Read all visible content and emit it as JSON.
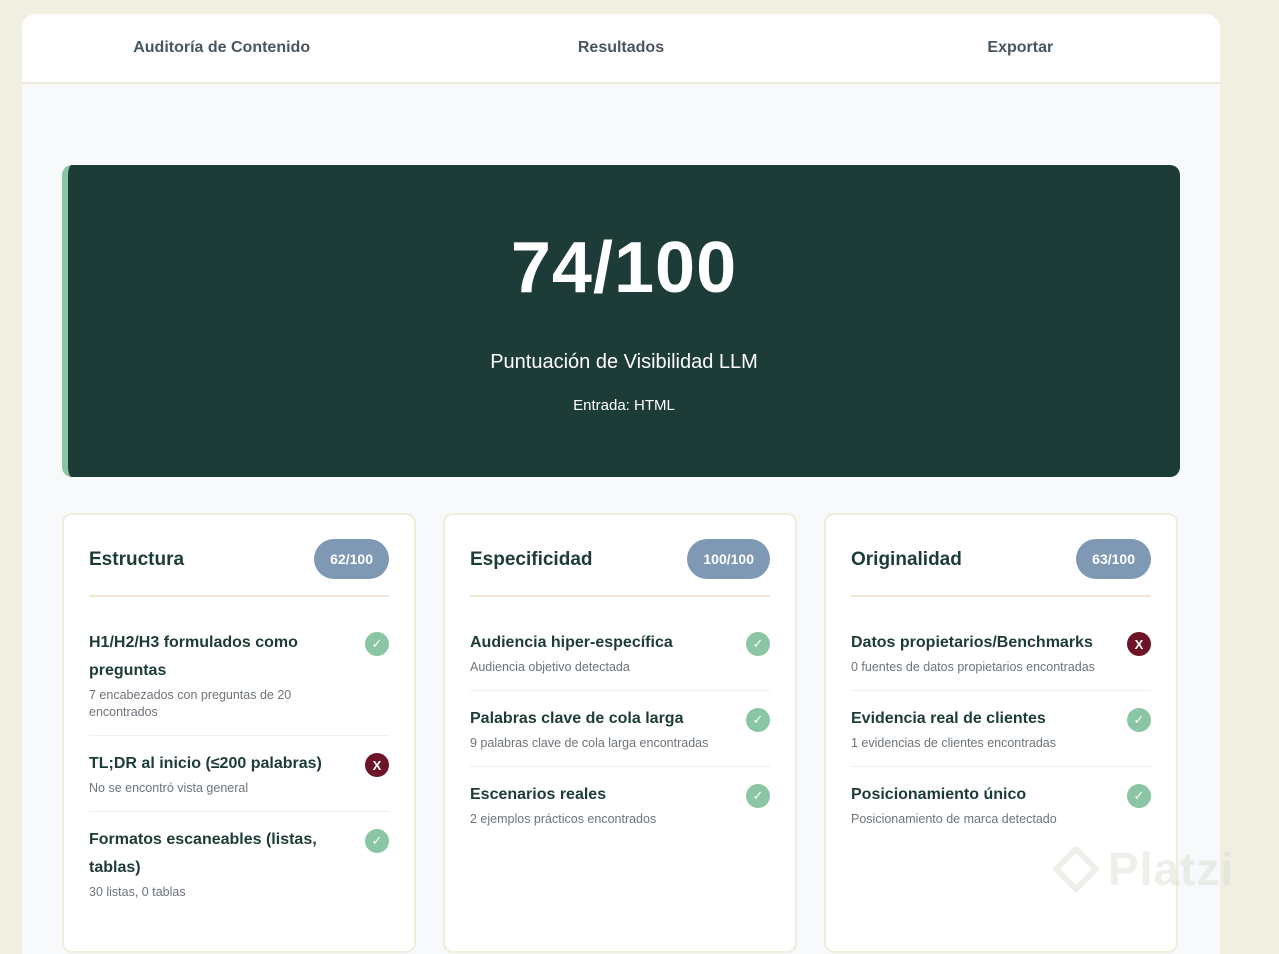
{
  "tabs": [
    {
      "label": "Auditoría de Contenido"
    },
    {
      "label": "Resultados"
    },
    {
      "label": "Exportar"
    }
  ],
  "hero": {
    "score": "74/100",
    "label": "Puntuación de Visibilidad LLM",
    "input": "Entrada: HTML"
  },
  "cards": [
    {
      "title": "Estructura",
      "badge": "62/100",
      "items": [
        {
          "title": "H1/H2/H3 formulados como preguntas",
          "desc": "7 encabezados con preguntas de 20 encontrados",
          "status": "ok"
        },
        {
          "title": "TL;DR al inicio (≤200 palabras)",
          "desc": "No se encontró vista general",
          "status": "fail"
        },
        {
          "title": "Formatos escaneables (listas, tablas)",
          "desc": "30 listas, 0 tablas",
          "status": "ok"
        }
      ]
    },
    {
      "title": "Especificidad",
      "badge": "100/100",
      "items": [
        {
          "title": "Audiencia hiper-específica",
          "desc": "Audiencia objetivo detectada",
          "status": "ok"
        },
        {
          "title": "Palabras clave de cola larga",
          "desc": "9 palabras clave de cola larga encontradas",
          "status": "ok"
        },
        {
          "title": "Escenarios reales",
          "desc": "2 ejemplos prácticos encontrados",
          "status": "ok"
        }
      ]
    },
    {
      "title": "Originalidad",
      "badge": "63/100",
      "items": [
        {
          "title": "Datos propietarios/Benchmarks",
          "desc": "0 fuentes de datos propietarios encontradas",
          "status": "fail"
        },
        {
          "title": "Evidencia real de clientes",
          "desc": "1 evidencias de clientes encontradas",
          "status": "ok"
        },
        {
          "title": "Posicionamiento único",
          "desc": "Posicionamiento de marca detectado",
          "status": "ok"
        }
      ]
    }
  ],
  "status_glyphs": {
    "ok": "✓",
    "fail": "X"
  },
  "watermark": {
    "text": "Platzi"
  },
  "colors": {
    "hero_bg": "#1d3b37",
    "accent_green": "#8ac6a5",
    "badge_bg": "#7f98b4",
    "fail_red": "#6d1428",
    "page_bg": "#f1eee2"
  }
}
